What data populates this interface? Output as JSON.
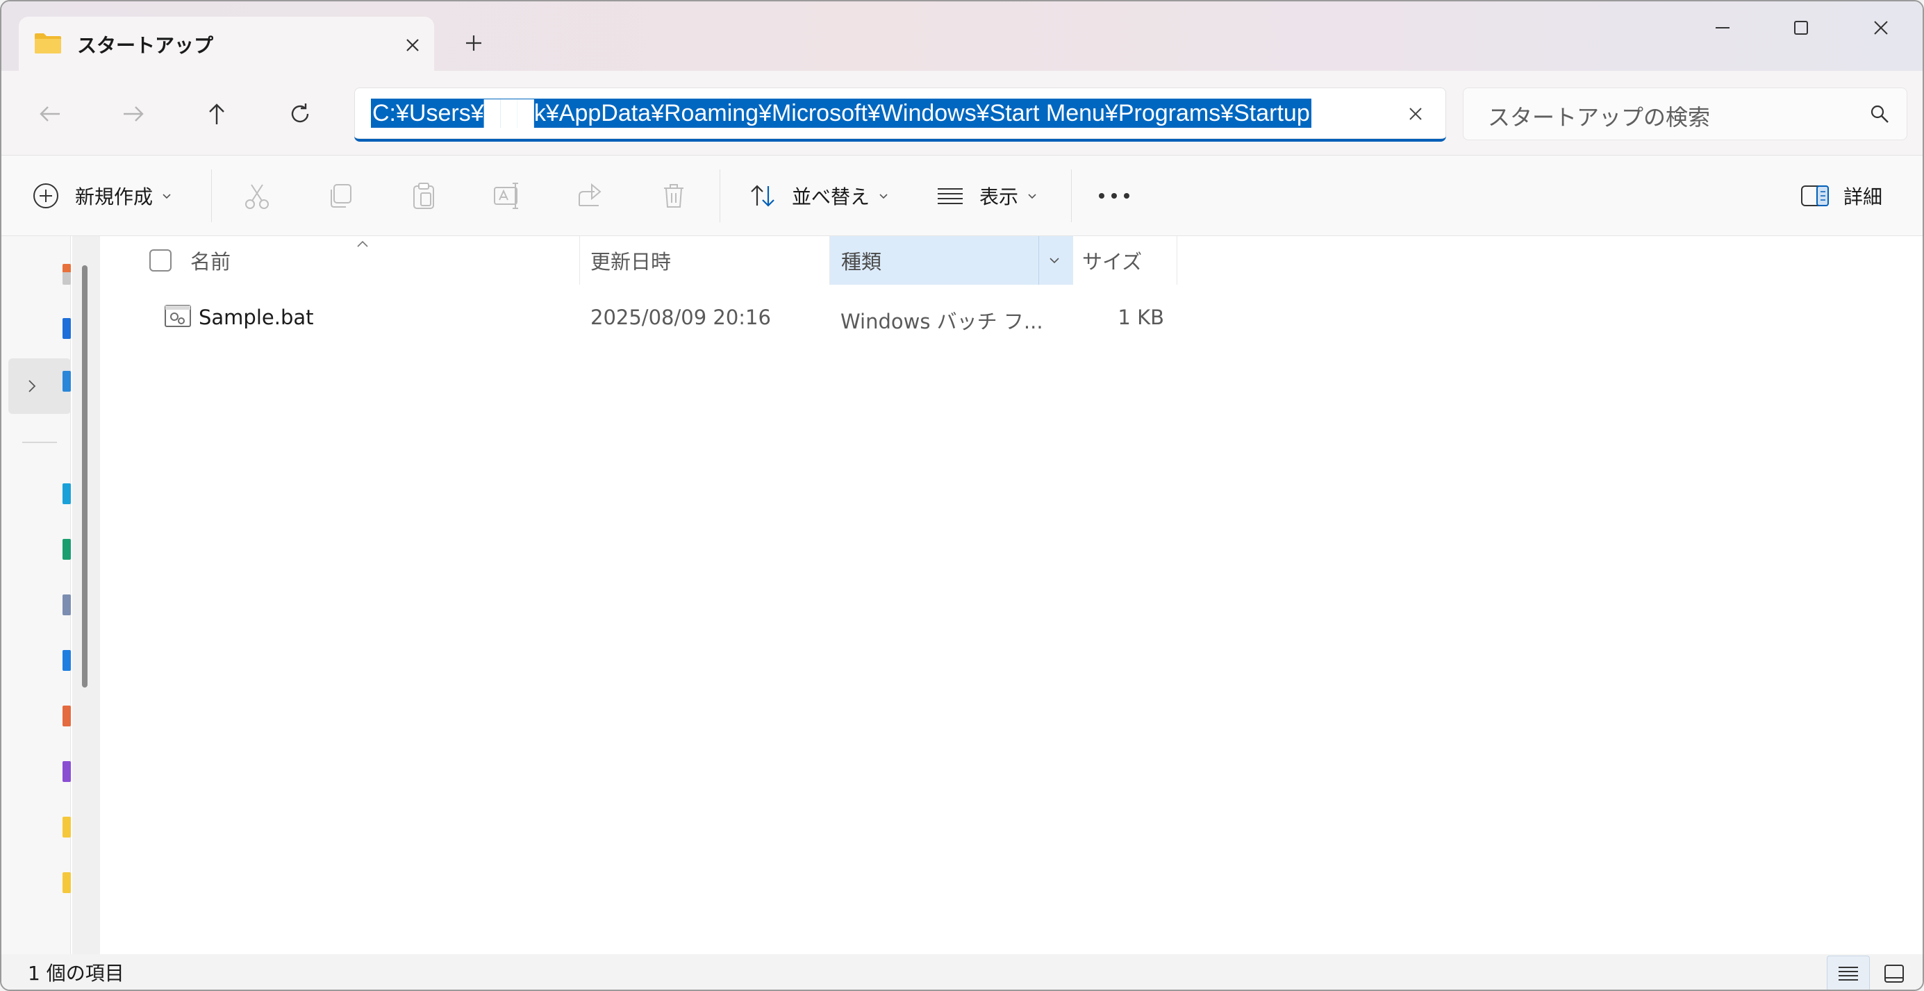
{
  "tab": {
    "title": "スタートアップ"
  },
  "address": {
    "path": "C:¥Users¥███k¥AppData¥Roaming¥Microsoft¥Windows¥Start Menu¥Programs¥Startup"
  },
  "search": {
    "placeholder": "スタートアップの検索"
  },
  "toolbar": {
    "new_label": "新規作成",
    "sort_label": "並べ替え",
    "view_label": "表示",
    "details_label": "詳細"
  },
  "columns": {
    "name": "名前",
    "modified": "更新日時",
    "type": "種類",
    "size": "サイズ"
  },
  "files": [
    {
      "name": "Sample.bat",
      "modified": "2025/08/09 20:16",
      "type": "Windows バッチ フ...",
      "size": "1 KB"
    }
  ],
  "status": {
    "item_count": "1 個の項目"
  },
  "colors": {
    "accent": "#005fb8",
    "selection": "#0067c0",
    "sort_column_bg": "#dcebfa"
  }
}
